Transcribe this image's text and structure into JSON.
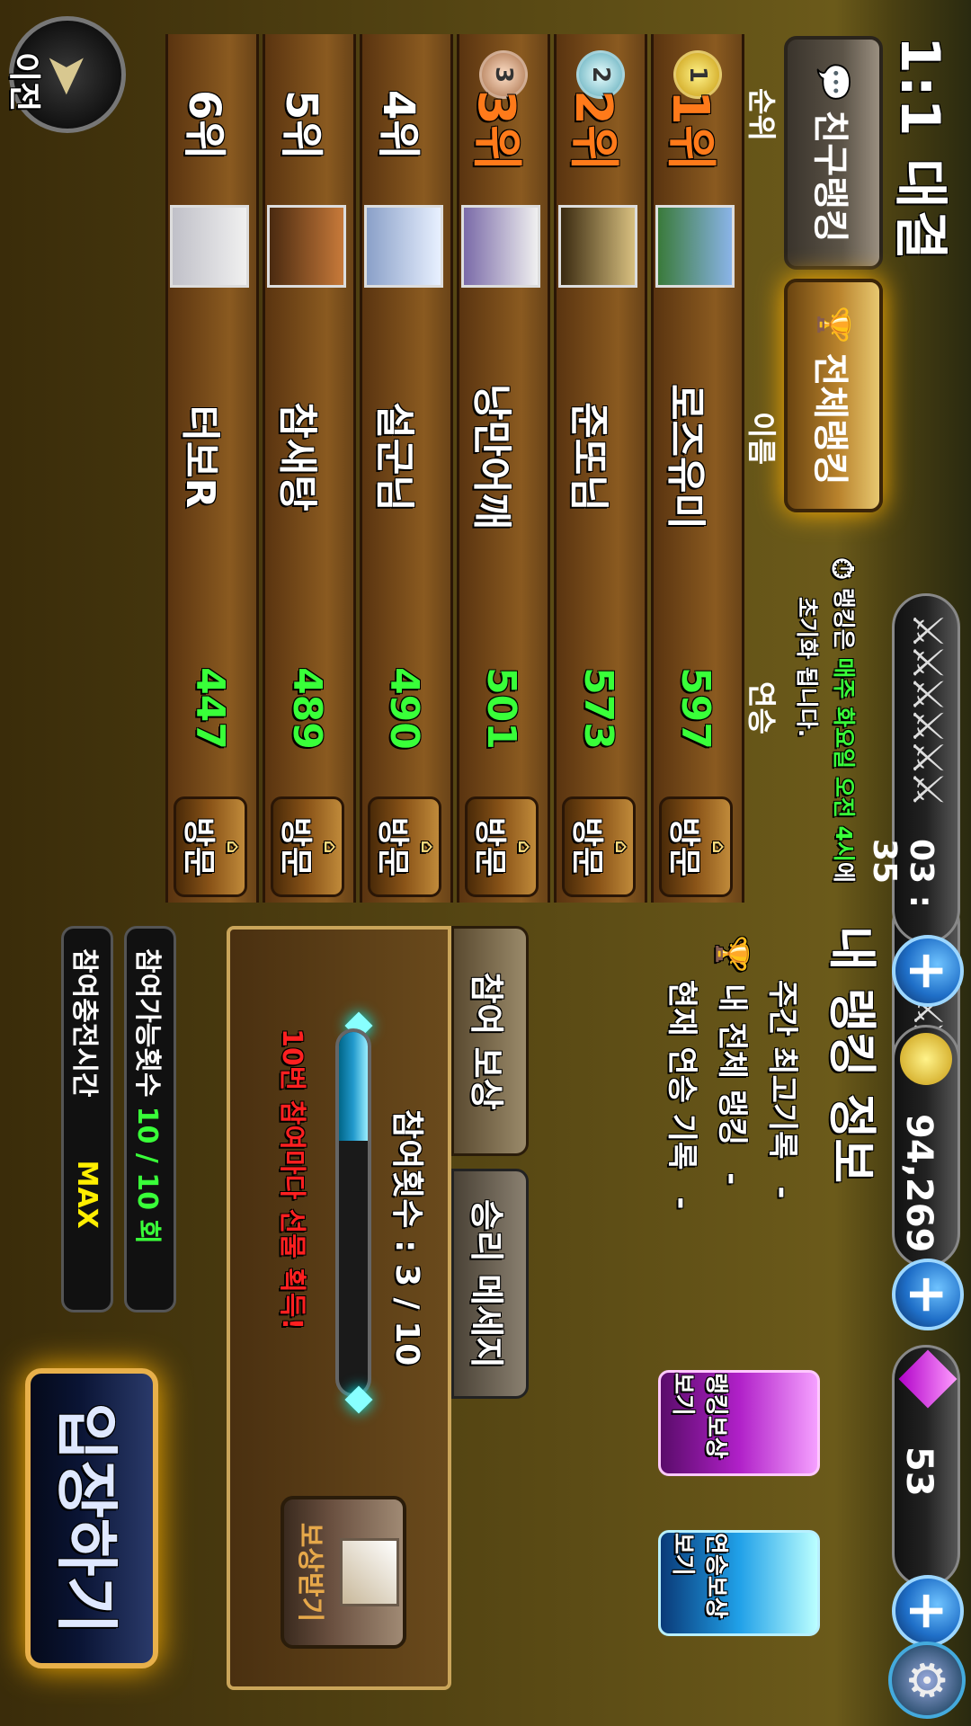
{
  "header": {
    "title": "1:1 대결",
    "timer": "03 : 35",
    "gold": "94,269",
    "gems": "53"
  },
  "tabs": {
    "friend_ranking": "친구랭킹",
    "total_ranking": "전체랭킹"
  },
  "reset_note": {
    "line1_prefix": "랭킹은 ",
    "line1_highlight": "매주 화요일 오전 4시",
    "line1_suffix": "에",
    "line2": "초기화 됩니다."
  },
  "table": {
    "headers": {
      "rank": "순위",
      "name": "이름",
      "streak": "연승"
    },
    "rows": [
      {
        "rank": "1위",
        "medal": "1",
        "name": "로즈유미",
        "score": "597",
        "visit": "방문"
      },
      {
        "rank": "2위",
        "medal": "2",
        "name": "준또님",
        "score": "573",
        "visit": "방문"
      },
      {
        "rank": "3위",
        "medal": "3",
        "name": "낭만어깨",
        "score": "501",
        "visit": "방문"
      },
      {
        "rank": "4위",
        "medal": "",
        "name": "설군님",
        "score": "490",
        "visit": "방문"
      },
      {
        "rank": "5위",
        "medal": "",
        "name": "참새탕",
        "score": "489",
        "visit": "방문"
      },
      {
        "rank": "6위",
        "medal": "",
        "name": "터보R",
        "score": "447",
        "visit": "방문"
      }
    ]
  },
  "my_ranking": {
    "title": "내 랭킹 정보",
    "weekly_best_label": "주간 최고기록",
    "weekly_best_value": "-",
    "overall_rank_label": "내 전체 랭킹",
    "overall_rank_value": "-",
    "current_streak_label": "현재 연승 기록",
    "current_streak_value": "-"
  },
  "reward_buttons": {
    "ranking_reward": "랭킹보상보기",
    "streak_reward": "연승보상보기"
  },
  "subtabs": {
    "participation_reward": "참여 보상",
    "victory_message": "승리 메세지"
  },
  "participation": {
    "count_label": "참여횟수 : 3 / 10",
    "progress": 0.3,
    "promo": "10번 참여마다 선물 획득!",
    "claim": "보상받기"
  },
  "stats": {
    "available_label": "참여가능횟수",
    "available_value": "10 / 10 회",
    "charge_label": "참여충전시간",
    "charge_value": "MAX"
  },
  "buttons": {
    "enter": "입장하기",
    "back": "이전"
  },
  "colors": {
    "highlight_green": "#39ff39",
    "promo_red": "#ff2020",
    "rank_orange": "#ff7a1a",
    "gold_accent": "#e8b04a"
  }
}
